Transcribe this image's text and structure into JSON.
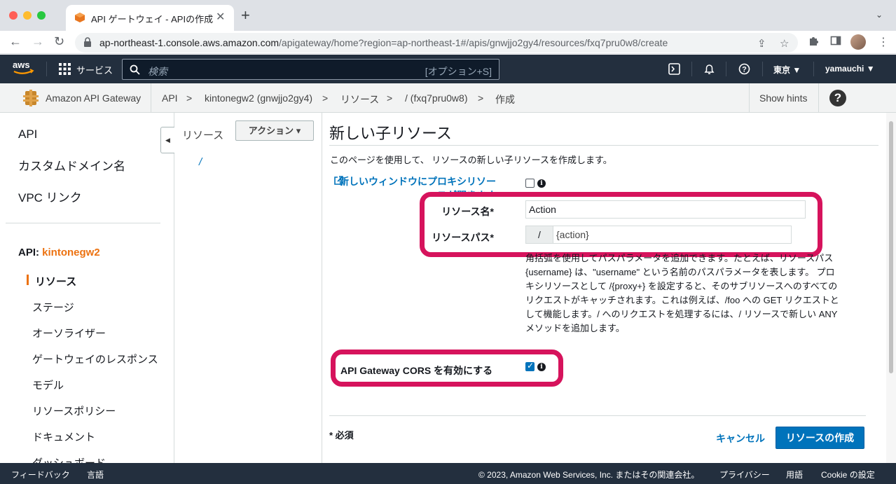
{
  "browser": {
    "tab_title": "API ゲートウェイ - APIの作成",
    "url_host": "ap-northeast-1.console.aws.amazon.com",
    "url_path": "/apigateway/home?region=ap-northeast-1#/apis/gnwjjo2gy4/resources/fxq7pru0w8/create"
  },
  "topnav": {
    "services_label": "サービス",
    "search_placeholder": "検索",
    "search_shortcut": "[オプション+S]",
    "region": "東京 ▼",
    "user": "yamauchi ▼"
  },
  "breadcrumb": {
    "service": "Amazon API Gateway",
    "items": [
      "API",
      ">",
      "kintonegw2 (gnwjjo2gy4)",
      ">",
      "リソース",
      ">",
      "/ (fxq7pru0w8)",
      ">",
      "作成"
    ],
    "show_hints": "Show hints"
  },
  "sidebar": {
    "top_items": [
      "API",
      "カスタムドメイン名",
      "VPC リンク"
    ],
    "api_prefix": "API: ",
    "api_name": "kintonegw2",
    "sub_items": [
      "リソース",
      "ステージ",
      "オーソライザー",
      "ゲートウェイのレスポンス",
      "モデル",
      "リソースポリシー",
      "ドキュメント",
      "ダッシュボード"
    ]
  },
  "tree": {
    "title": "リソース",
    "actions_label": "アクション ▾",
    "root": "/"
  },
  "form": {
    "title": "新しい子リソース",
    "description": "このページを使用して、 リソースの新しい子リソースを作成します。",
    "proxy_link": "新しいウィンドウにプロキシリソースが開きます",
    "resource_name_label": "リソース名*",
    "resource_name_value": "Action",
    "resource_path_label": "リソースパス*",
    "resource_path_prefix": "/",
    "resource_path_value": "{action}",
    "help_lines": [
      "角括弧を使用してパスパラメータを追加できます。たとえば、リソースパス",
      "{username} は、\"username\" という名前のパスパラメータを表します。 プロ",
      "キシリソースとして /{proxy+} を設定すると、そのサブリソースへのすべての",
      "リクエストがキャッチされます。これは例えば、/foo への GET リクエストと",
      "して機能します。/ へのリクエストを処理するには、/ リソースで新しい ANY",
      "メソッドを追加します。"
    ],
    "cors_label": "API Gateway CORS を有効にする",
    "cors_checked": true,
    "proxy_checked": false,
    "required_note": "* 必須",
    "cancel_label": "キャンセル",
    "create_label": "リソースの作成"
  },
  "footer": {
    "feedback": "フィードバック",
    "language": "言語",
    "copyright": "© 2023, Amazon Web Services, Inc. またはその関連会社。",
    "privacy": "プライバシー",
    "terms": "用語",
    "cookie": "Cookie の設定"
  },
  "colors": {
    "aws_nav": "#232f3e",
    "accent_orange": "#ec7211",
    "link_blue": "#0073bb",
    "highlight": "#d6135c"
  }
}
